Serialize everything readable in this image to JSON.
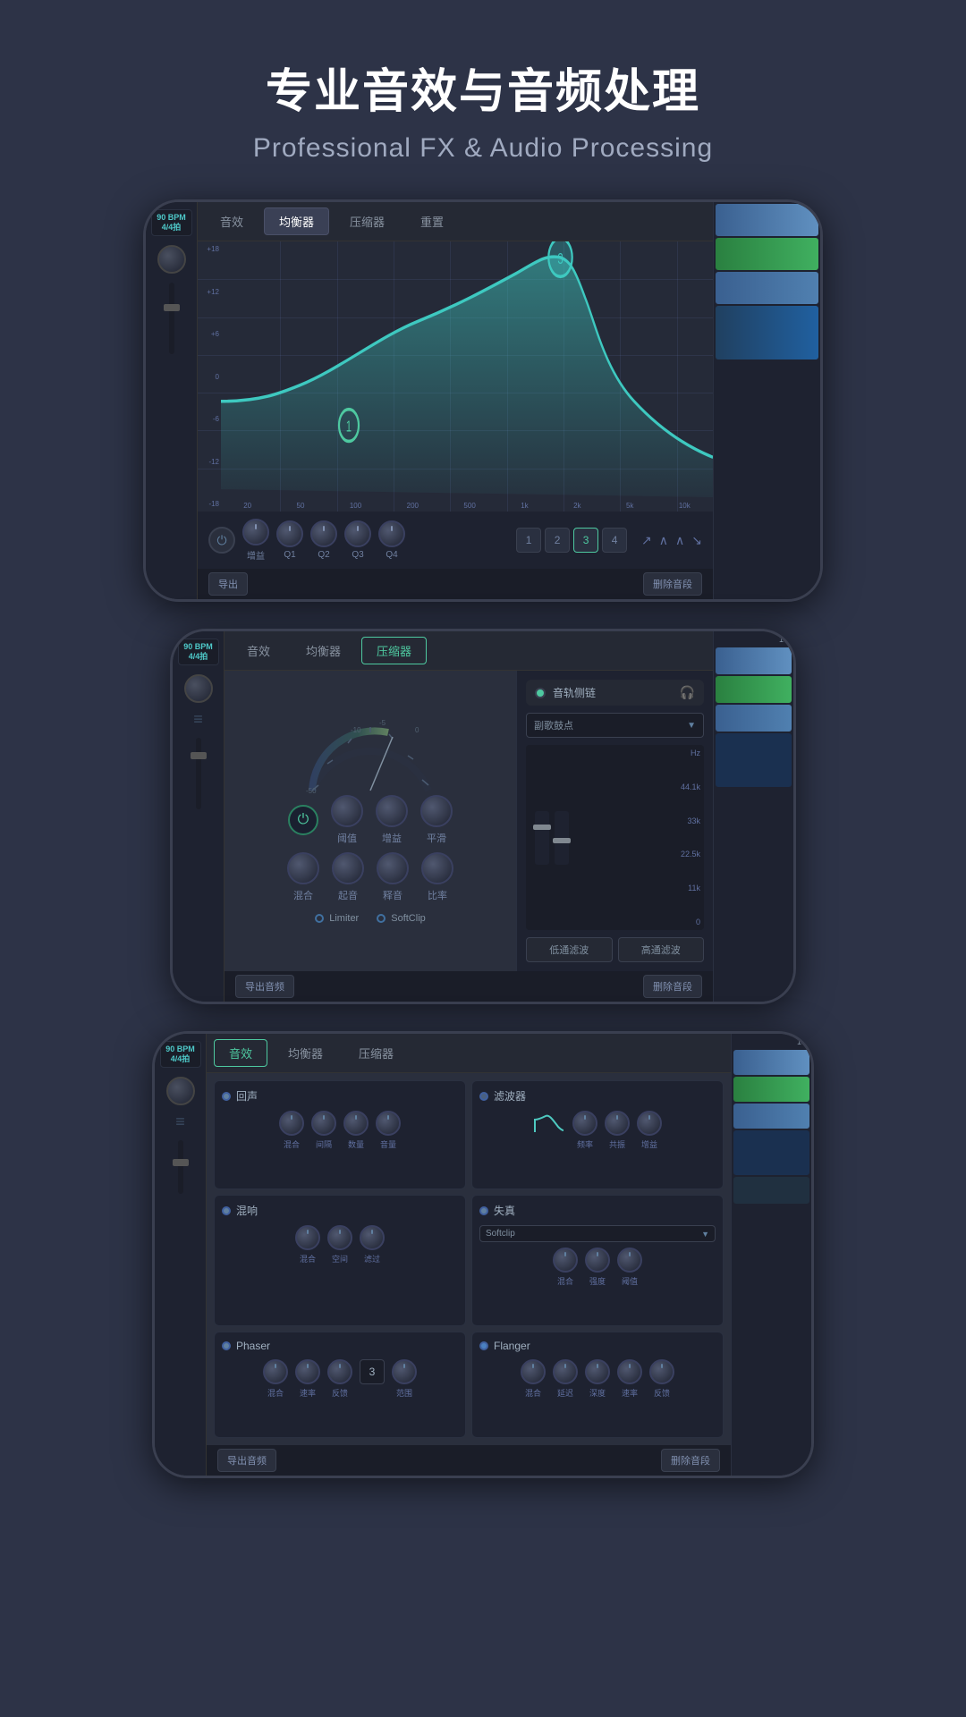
{
  "page": {
    "bg_color": "#2d3347",
    "header": {
      "title_cn": "专业音效与音频处理",
      "title_en": "Professional FX & Audio Processing"
    }
  },
  "phone1": {
    "bpm": "90 BPM",
    "time_sig": "4/4拍",
    "tabs": [
      "音效",
      "均衡器",
      "压缩器",
      "重置"
    ],
    "active_tab": "均衡器",
    "eq": {
      "y_labels": [
        "+18",
        "+12",
        "+6",
        "0",
        "-6",
        "-12",
        "-18"
      ],
      "x_labels": [
        "20",
        "50",
        "100",
        "200",
        "500",
        "1k",
        "2k",
        "5k",
        "10k"
      ],
      "band_numbers": [
        "1",
        "2",
        "3",
        "4"
      ],
      "active_bands": [
        "3"
      ],
      "knob_labels": [
        "增益",
        "Q1",
        "Q2",
        "Q3",
        "Q4"
      ]
    },
    "bottom": {
      "export": "导出",
      "remove": "删除音段"
    }
  },
  "phone2": {
    "bpm": "90 BPM",
    "time_sig": "4/4拍",
    "tabs": [
      "音效",
      "均衡器",
      "压缩器"
    ],
    "active_tab": "压缩器",
    "comp": {
      "knob_labels": [
        "阈值",
        "增益",
        "平滑",
        "混合",
        "起音",
        "释音",
        "比率"
      ],
      "sidechain_label": "音轨侧链",
      "sidechain_source": "副歌鼓点",
      "freq_labels": [
        "Hz",
        "44.1k",
        "33k",
        "22.5k",
        "11k",
        "0"
      ],
      "low_filter": "低通滤波",
      "high_filter": "高通滤波",
      "limiter_options": [
        "Limiter",
        "SoftClip"
      ]
    },
    "bottom": {
      "export": "导出音频",
      "remove": "删除音段"
    }
  },
  "phone3": {
    "bpm": "90 BPM",
    "time_sig": "4/4拍",
    "tabs": [
      "音效",
      "均衡器",
      "压缩器"
    ],
    "active_tab": "音效",
    "effects": {
      "reverb": {
        "title": "回声",
        "knob_labels": [
          "混合",
          "间隔",
          "数量",
          "音量"
        ]
      },
      "filter": {
        "title": "滤波器",
        "knob_labels": [
          "频率",
          "共振",
          "增益"
        ]
      },
      "chorus": {
        "title": "混响",
        "knob_labels": [
          "混合",
          "空间",
          "滤过"
        ]
      },
      "distortion": {
        "title": "失真",
        "dropdown": "Softclip",
        "knob_labels": [
          "混合",
          "强度",
          "阈值"
        ]
      },
      "phaser": {
        "title": "Phaser",
        "knob_labels": [
          "混合",
          "速率",
          "反馈",
          "范围"
        ],
        "stage_value": "3"
      },
      "flanger": {
        "title": "Flanger",
        "knob_labels": [
          "混合",
          "延迟",
          "深度",
          "速率",
          "反馈"
        ]
      }
    },
    "bottom": {
      "export": "导出音频",
      "remove": "删除音段"
    }
  }
}
